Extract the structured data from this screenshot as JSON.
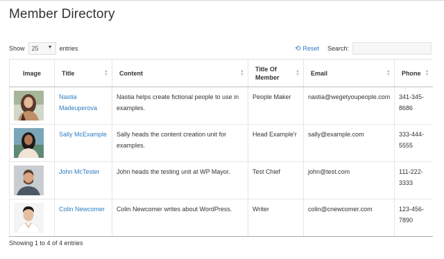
{
  "page": {
    "title": "Member Directory"
  },
  "controls": {
    "show_label": "Show",
    "page_length": "25",
    "entries_label": "entries",
    "reset_label": "Reset",
    "search_label": "Search:",
    "search_value": ""
  },
  "table": {
    "columns": [
      "Image",
      "Title",
      "Content",
      "Title Of Member",
      "Email",
      "Phone"
    ],
    "rows": [
      {
        "avatar": "woman-portrait-1",
        "name": "Nastia Madeuperova",
        "content": "Nastia helps create fictional people to use in examples.",
        "member_title": "People Maker",
        "email": "nastia@wegetyoupeople.com",
        "phone": "341-345-8686"
      },
      {
        "avatar": "woman-portrait-2",
        "name": "Sally McExample",
        "content": "Sally heads the content creation unit for examples.",
        "member_title": "Head Example'r",
        "email": "sally@example.com",
        "phone": "333-444-5555"
      },
      {
        "avatar": "man-portrait-1",
        "name": "John McTester",
        "content": "John heads the testing unit at WP Mayor.",
        "member_title": "Test Chief",
        "email": "john@test.com",
        "phone": "111-222-3333"
      },
      {
        "avatar": "man-portrait-2",
        "name": "Colin Newcomer",
        "content": "Colin Newcomer writes about WordPress.",
        "member_title": "Writer",
        "email": "colin@cnewcomer.com",
        "phone": "123-456-7890"
      }
    ]
  },
  "footer": {
    "info": "Showing 1 to 4 of 4 entries"
  }
}
